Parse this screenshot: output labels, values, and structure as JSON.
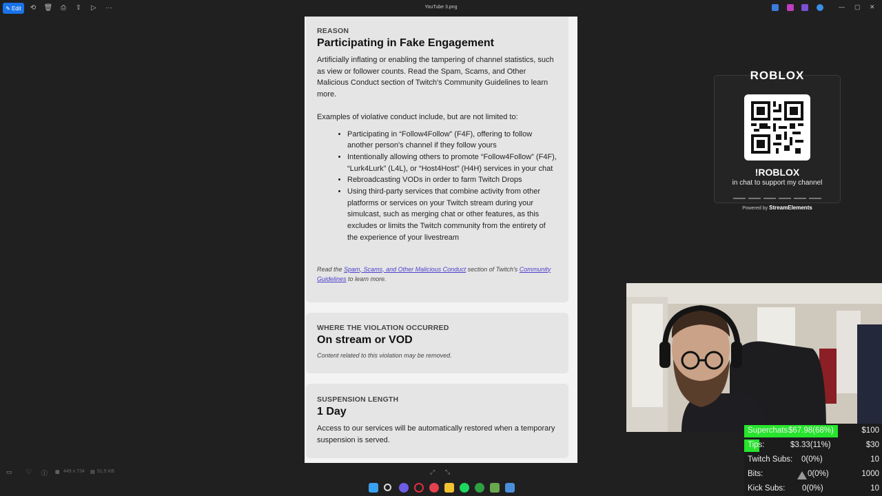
{
  "toolbar": {
    "edit_label": "Edit",
    "file_title": "YouTube 3.png"
  },
  "document": {
    "reason": {
      "label": "REASON",
      "title": "Participating in Fake Engagement",
      "paragraph": "Artificially inflating or enabling the tampering of channel statistics, such as view or follower counts. Read the Spam, Scams, and Other Malicious Conduct section of Twitch's Community Guidelines to learn more.",
      "examples_intro": "Examples of violative conduct include, but are not limited to:",
      "bullets": [
        "Participating in “Follow4Follow” (F4F), offering to follow another person's channel if they follow yours",
        "Intentionally allowing others to promote “Follow4Follow” (F4F), “Lurk4Lurk” (L4L), or “Host4Host” (H4H) services in your chat",
        "Rebroadcasting VODs in order to farm Twitch Drops",
        "Using third-party services that combine activity from other platforms or services on your Twitch stream during your simulcast, such as merging chat or other features, as this excludes or limits the Twitch community from the entirety of the experience of your livestream"
      ],
      "footer_read": "Read the",
      "footer_link1": "Spam, Scams, and Other Malicious Conduct",
      "footer_mid": "section of Twitch's",
      "footer_link2": "Community Guidelines",
      "footer_end": "to learn more."
    },
    "where": {
      "label": "WHERE THE VIOLATION OCCURRED",
      "title": "On stream or VOD",
      "note": "Content related to this violation may be removed."
    },
    "suspension": {
      "label": "SUSPENSION LENGTH",
      "title": "1 Day",
      "text": "Access to our services will be automatically restored when a temporary suspension is served."
    }
  },
  "roblox": {
    "logo": "ROBLOX",
    "command": "!ROBLOX",
    "subtitle": "in chat to support my channel",
    "powered_prefix": "Powered by",
    "powered_brand": "StreamElements"
  },
  "goals": [
    {
      "name": "Superchats",
      "value": "$67.98(68%)",
      "target": "$100",
      "fraction": 0.68
    },
    {
      "name": "Tips:",
      "value": "$3.33(11%)",
      "target": "$30",
      "fraction": 0.11
    },
    {
      "name": "Twitch Subs:",
      "value": "0(0%)",
      "target": "10",
      "fraction": 0
    },
    {
      "name": "Bits:",
      "value": "0(0%)",
      "target": "1000",
      "fraction": 0
    },
    {
      "name": "Kick Subs:",
      "value": "0(0%)",
      "target": "10",
      "fraction": 0
    }
  ],
  "status": {
    "dimensions": "449 x 734",
    "filesize": "51.5 KB"
  },
  "colors": {
    "goal_fill": "#27e52d",
    "accent": "#1a73e8",
    "link": "#4b3ec8"
  }
}
